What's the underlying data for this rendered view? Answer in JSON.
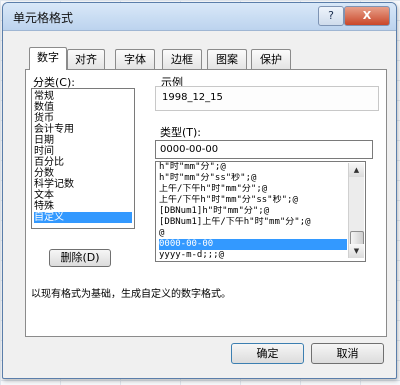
{
  "window": {
    "title": "单元格格式",
    "help_label": "?",
    "close_label": "X"
  },
  "tabs": [
    {
      "label": "数字",
      "active": true
    },
    {
      "label": "对齐",
      "active": false
    },
    {
      "label": "字体",
      "active": false
    },
    {
      "label": "边框",
      "active": false
    },
    {
      "label": "图案",
      "active": false
    },
    {
      "label": "保护",
      "active": false
    }
  ],
  "category": {
    "label": "分类(C):",
    "items": [
      "常规",
      "数值",
      "货币",
      "会计专用",
      "日期",
      "时间",
      "百分比",
      "分数",
      "科学记数",
      "文本",
      "特殊",
      "自定义"
    ],
    "selected_index": 11
  },
  "sample": {
    "label": "示例",
    "value": "1998_12_15"
  },
  "type": {
    "label": "类型(T):",
    "input_value": "0000-00-00",
    "items": [
      "h\"时\"mm\"分\";@",
      "h\"时\"mm\"分\"ss\"秒\";@",
      "上午/下午h\"时\"mm\"分\";@",
      "上午/下午h\"时\"mm\"分\"ss\"秒\";@",
      "[DBNum1]h\"时\"mm\"分\";@",
      "[DBNum1]上午/下午h\"时\"mm\"分\";@",
      "@",
      "0000-00-00",
      "yyyy-m-d;;;@"
    ],
    "selected_index": 7
  },
  "delete_button": "删除(D)",
  "hint": "以现有格式为基础，生成自定义的数字格式。",
  "ok_button": "确定",
  "cancel_button": "取消"
}
